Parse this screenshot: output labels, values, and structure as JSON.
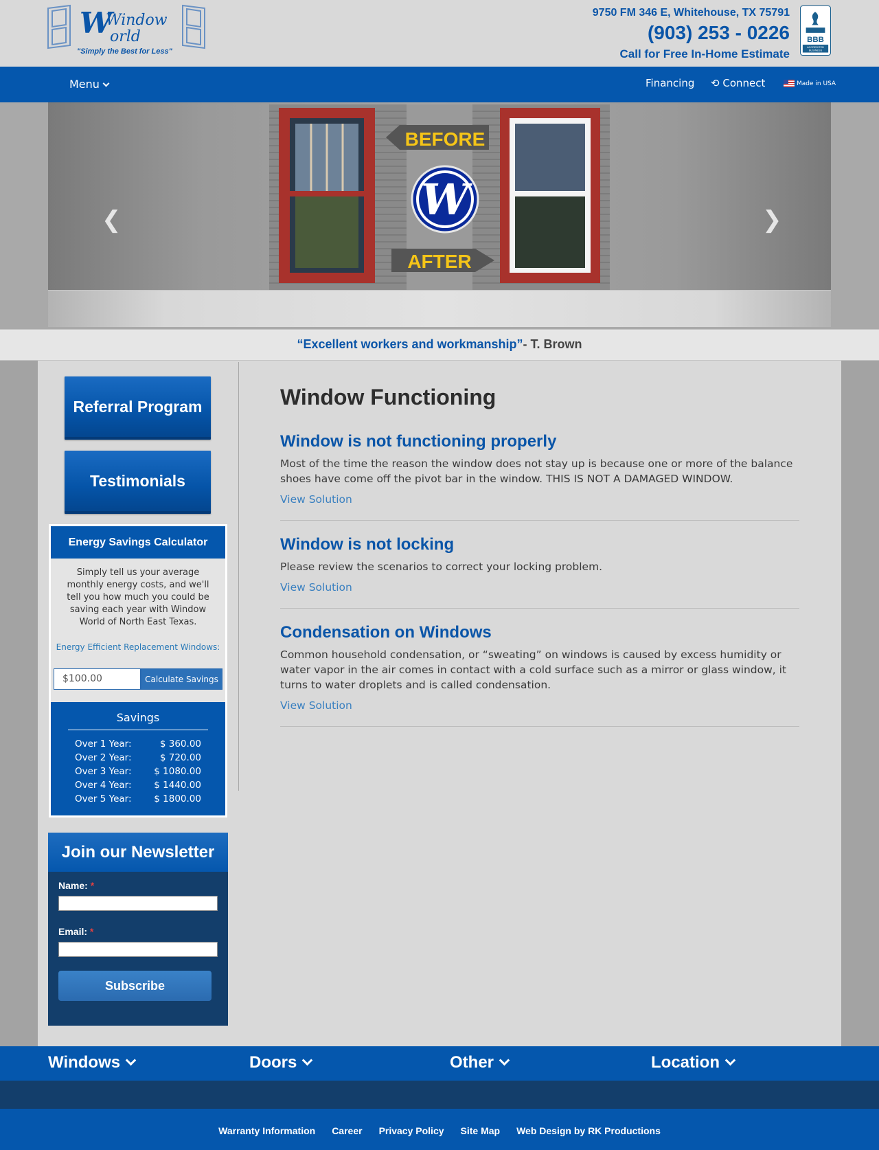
{
  "header": {
    "logo_text_top": "Window",
    "logo_text_bottom": "World",
    "tagline": "\"Simply the Best for Less\"",
    "address": "9750 FM 346 E, Whitehouse, TX 75791",
    "phone": "(903) 253 - 0226",
    "cta": "Call for Free In-Home Estimate",
    "bbb_text": "BBB",
    "bbb_sub": "ACCREDITED BUSINESS"
  },
  "nav": {
    "menu": "Menu",
    "financing": "Financing",
    "connect": "Connect",
    "made_in_usa": "Made in USA"
  },
  "hero": {
    "before": "BEFORE",
    "after": "AFTER",
    "badge": "W"
  },
  "testimonial": {
    "quote": "“Excellent workers and workmanship”",
    "author": "- T. Brown"
  },
  "sidebar": {
    "referral": "Referral Program",
    "testimonials": "Testimonials",
    "calculator": {
      "title": "Energy Savings Calculator",
      "description": "Simply tell us your average monthly energy costs, and we'll tell you how much you could be saving each year with Window World of North East Texas.",
      "link": "Energy Efficient Replacement Windows:",
      "input_value": "$100.00",
      "button": "Calculate Savings",
      "savings_title": "Savings",
      "rows": [
        {
          "label": "Over 1 Year:",
          "value": "$ 360.00"
        },
        {
          "label": "Over 2 Year:",
          "value": "$ 720.00"
        },
        {
          "label": "Over 3 Year:",
          "value": "$ 1080.00"
        },
        {
          "label": "Over 4 Year:",
          "value": "$ 1440.00"
        },
        {
          "label": "Over 5 Year:",
          "value": "$ 1800.00"
        }
      ]
    },
    "newsletter": {
      "title": "Join our Newsletter",
      "name_label": "Name:",
      "email_label": "Email:",
      "required": "*",
      "button": "Subscribe"
    }
  },
  "main": {
    "title": "Window Functioning",
    "items": [
      {
        "heading": "Window is not functioning properly",
        "text": "Most of the time the reason the window does not stay up is because one or more of the balance shoes have come off the pivot bar in the window. THIS IS NOT A DAMAGED WINDOW.",
        "link": "View Solution"
      },
      {
        "heading": "Window is not locking",
        "text": "Please review the scenarios to correct your locking problem.",
        "link": "View Solution"
      },
      {
        "heading": "Condensation on Windows",
        "text": "Common household condensation, or “sweating” on windows is caused by excess humidity or water vapor in the air comes in contact with a cold surface such as a mirror or glass window, it turns to water droplets and is called condensation.",
        "link": "View Solution"
      }
    ]
  },
  "footer": {
    "nav": [
      "Windows",
      "Doors",
      "Other",
      "Location"
    ],
    "links": [
      "Warranty Information",
      "Career",
      "Privacy Policy",
      "Site Map",
      "Web Design by RK Productions"
    ]
  },
  "colors": {
    "brand_blue": "#0557ad",
    "navy": "#133e6b",
    "link_blue": "#3a80c0",
    "before_after_yellow": "#f5c518",
    "window_frame_red": "#a8322c"
  }
}
